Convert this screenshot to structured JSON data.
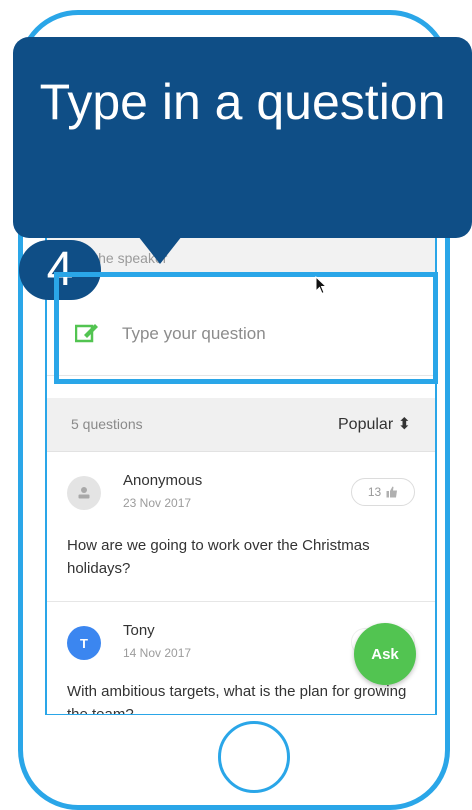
{
  "callout": {
    "text": "Type in a question",
    "step": "4"
  },
  "screen": {
    "section_label": "Ask the speaker",
    "input": {
      "placeholder": "Type your question"
    },
    "questions_bar": {
      "count": "5 questions",
      "sort": "Popular ⬍"
    },
    "questions": [
      {
        "author": "Anonymous",
        "avatar_letter": "",
        "date": "23 Nov 2017",
        "likes": "13",
        "text": "How are we going to work over the Christmas holidays?"
      },
      {
        "author": "Tony",
        "avatar_letter": "T",
        "date": "14 Nov 2017",
        "likes": "",
        "text": "With ambitious targets, what is the plan for growing the team?"
      }
    ],
    "ask_button": "Ask"
  },
  "colors": {
    "frame": "#2aa6e8",
    "callout": "#0f4e86",
    "ask": "#52c451",
    "avatar_blue": "#3b86f0"
  },
  "icons": [
    "edit-icon",
    "person-icon",
    "thumbs-up-icon",
    "cursor-icon",
    "sort-arrows-icon"
  ]
}
